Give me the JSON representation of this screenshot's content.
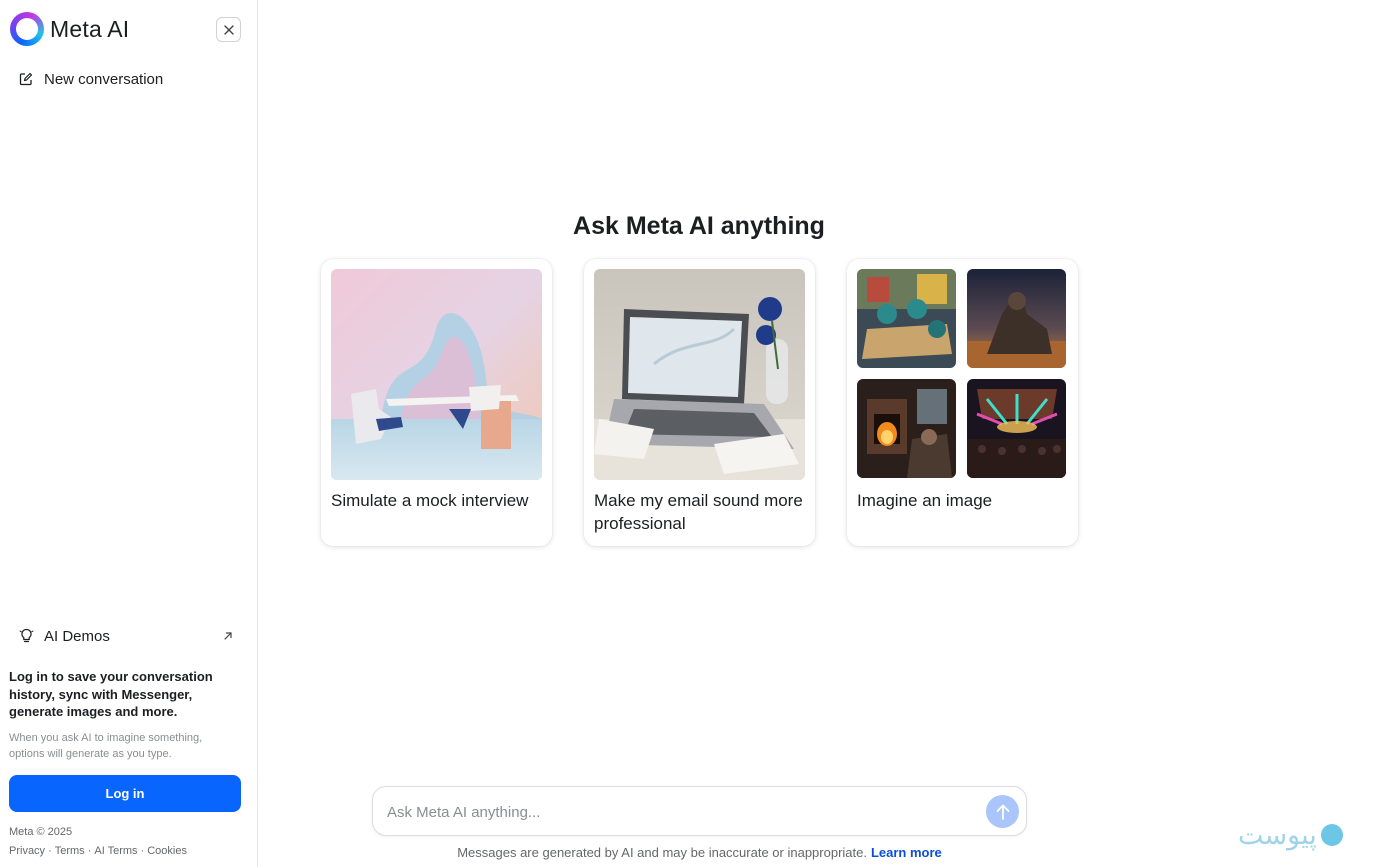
{
  "sidebar": {
    "brand": "Meta AI",
    "new_conversation": "New conversation",
    "ai_demos": "AI Demos",
    "login_message": "Log in to save your conversation history, sync with Messenger, generate images and more.",
    "login_sub": "When you ask AI to imagine something, options will generate as you type.",
    "login_button": "Log in",
    "copyright": "Meta © 2025",
    "footer_links": [
      "Privacy",
      "Terms",
      "AI Terms",
      "Cookies"
    ]
  },
  "main": {
    "headline": "Ask Meta AI anything",
    "cards": [
      {
        "title": "Simulate a mock interview"
      },
      {
        "title": "Make my email sound more professional"
      },
      {
        "title": "Imagine an image"
      }
    ]
  },
  "composer": {
    "placeholder": "Ask Meta AI anything..."
  },
  "disclaimer": {
    "text": "Messages are generated by AI and may be inaccurate or inappropriate.",
    "link": "Learn more"
  },
  "watermark": {
    "text": "پیوست"
  },
  "colors": {
    "accent": "#0866ff",
    "send_disabled": "#a9c5fb",
    "link": "#0b4fd6"
  },
  "icons": [
    "close-icon",
    "edit-icon",
    "lightbulb-icon",
    "external-link-icon",
    "arrow-up-icon"
  ]
}
